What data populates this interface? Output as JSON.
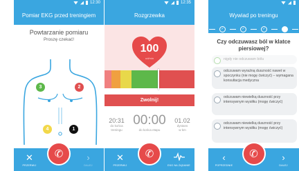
{
  "screens": {
    "ekg": {
      "status_time": "12:30",
      "title": "Pomiar EKG przed treningiem",
      "heading": "Powtarzanie pomiaru",
      "subheading": "Proszę czekać!",
      "markers": [
        "3",
        "2",
        "4",
        "1"
      ],
      "nav_left": "PRZERWIJ",
      "nav_right": "DALEJ"
    },
    "warmup": {
      "status_time": "12:35",
      "title": "Rozgrzewka",
      "heart_rate": "100",
      "heart_rate_unit": "ud/min",
      "alert": "Zwolnij!",
      "time_left_training": "20:31",
      "time_left_training_label_1": "do końca",
      "time_left_training_label_2": "treningu",
      "time_left_stage": "00:00",
      "time_left_stage_label": "do końca etapu",
      "distance": "01.02",
      "distance_label_1": "dystans",
      "distance_label_2": "w km",
      "nav_left": "PRZERWIJ",
      "nav_right": "EKG NA ŻĄDANIE"
    },
    "interview": {
      "title": "Wywiad po treningu",
      "steps": [
        "✓",
        "✓",
        "✓"
      ],
      "question": "Czy odczuwasz ból w klatce piersiowej?",
      "options": [
        "nigdy nie odczuwam bólu",
        "odczuwam wyraźną duszność nawet w spoczynku (nie mogę ćwiczyć) – wymagana konsultacja medyczna",
        "odczuwam niewielką duszność przy intensywnym wysiłku (mogę ćwiczyć)",
        "odczuwam niewielką duszność przy intensywnym wysiłku (mogę ćwiczyć)"
      ],
      "nav_left": "POPRZEDNIE",
      "nav_right": "DALEJ"
    }
  },
  "colors": {
    "primary": "#3aa6e0",
    "danger": "#e64a4a",
    "zone_red": "#e05050",
    "zone_yellow": "#e8d84a",
    "zone_green": "#5db84a",
    "zone_orange": "#f0a040"
  },
  "icons": {
    "call": "phone-icon",
    "close": "close-icon",
    "next": "chevron-right-icon",
    "prev": "chevron-left-icon",
    "ekg": "heartbeat-icon"
  }
}
